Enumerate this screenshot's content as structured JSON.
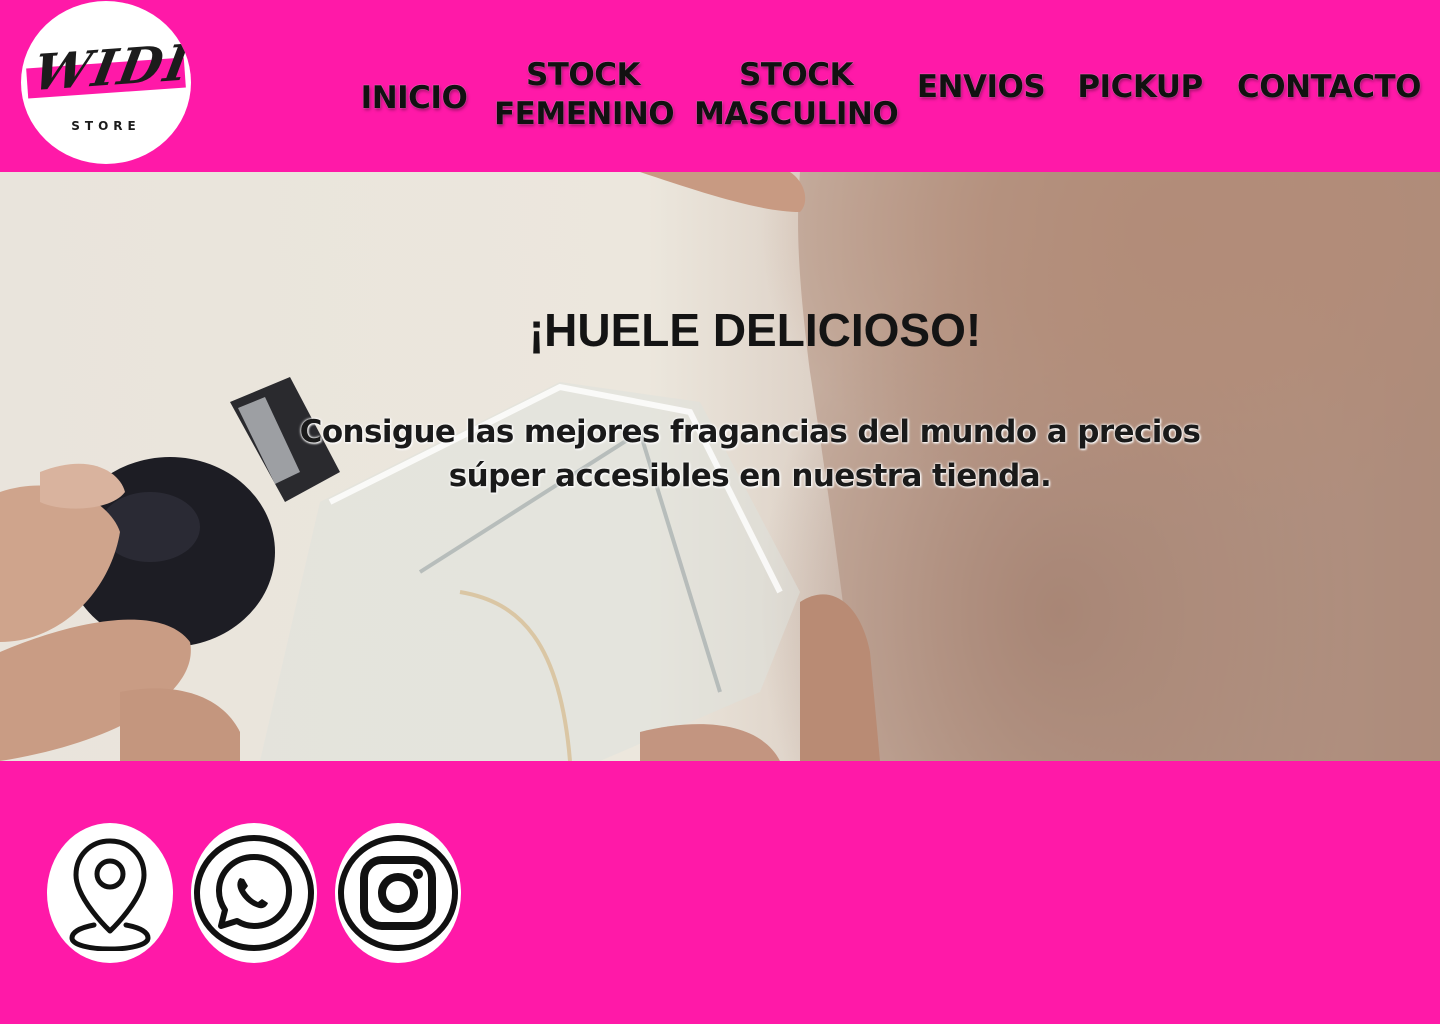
{
  "header": {
    "logo": {
      "word": "WIDI",
      "sub": "STORE"
    },
    "nav": [
      {
        "label": "INICIO",
        "lines": [
          "INICIO"
        ]
      },
      {
        "label": "STOCK FEMENINO",
        "lines": [
          "STOCK",
          "FEMENINO"
        ]
      },
      {
        "label": "STOCK MASCULINO",
        "lines": [
          "STOCK",
          "MASCULINO"
        ]
      },
      {
        "label": "ENVIOS",
        "lines": [
          "ENVIOS"
        ]
      },
      {
        "label": "PICKUP",
        "lines": [
          "PICKUP"
        ]
      },
      {
        "label": "CONTACTO",
        "lines": [
          "CONTACTO"
        ]
      }
    ]
  },
  "hero": {
    "title": "¡HUELE DELICIOSO!",
    "text": "Consigue las mejores fragancias del mundo a precios súper accesibles en nuestra tienda."
  },
  "footer": {
    "social": [
      {
        "icon": "location-pin-icon"
      },
      {
        "icon": "whatsapp-icon"
      },
      {
        "icon": "instagram-icon"
      }
    ]
  },
  "colors": {
    "brand_pink": "#ff19a8",
    "text_dark": "#111111",
    "white": "#ffffff"
  }
}
